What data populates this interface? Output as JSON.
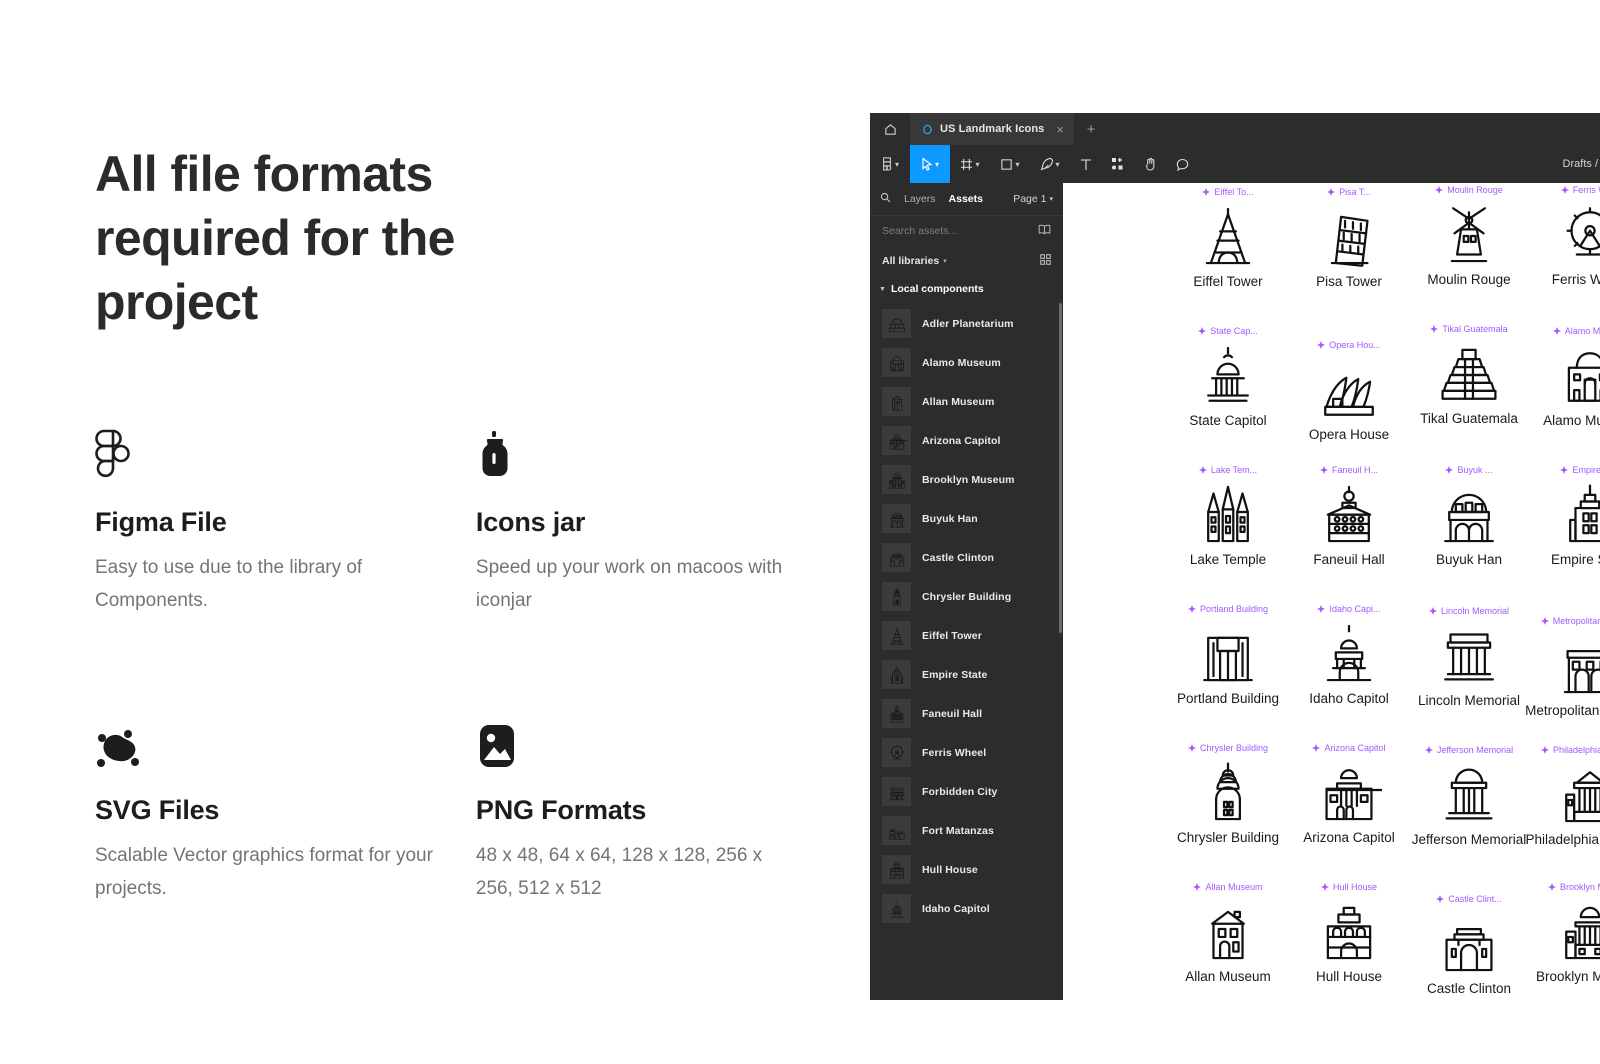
{
  "marketing": {
    "headline": "All file formats required for the project",
    "features": [
      {
        "icon": "figma-logo-icon",
        "title": "Figma File",
        "desc": "Easy to use due to the library of Components."
      },
      {
        "icon": "jar-icon",
        "title": "Icons jar",
        "desc": "Speed up your work on macoos with iconjar"
      },
      {
        "icon": "vector-node-icon",
        "title": "SVG Files",
        "desc": "Scalable Vector graphics format for your projects."
      },
      {
        "icon": "image-icon",
        "title": "PNG Formats",
        "desc": "48 x 48, 64 x 64, 128 x 128, 256 x 256, 512 x 512"
      }
    ]
  },
  "figma": {
    "tab": {
      "title": "US Landmark Icons",
      "close": "×",
      "new": "+"
    },
    "toolbar": {
      "tools": [
        {
          "name": "figma-menu-icon",
          "caret": true,
          "active": false
        },
        {
          "name": "move-tool-icon",
          "caret": true,
          "active": true
        },
        {
          "name": "frame-tool-icon",
          "caret": true,
          "active": false
        },
        {
          "name": "shape-tool-icon",
          "caret": true,
          "active": false
        },
        {
          "name": "pen-tool-icon",
          "caret": true,
          "active": false
        },
        {
          "name": "text-tool-icon",
          "caret": false,
          "active": false
        },
        {
          "name": "components-tool-icon",
          "caret": false,
          "active": false
        },
        {
          "name": "hand-tool-icon",
          "caret": false,
          "active": false
        },
        {
          "name": "comment-tool-icon",
          "caret": false,
          "active": false
        }
      ],
      "breadcrumb": "Drafts /"
    },
    "panel": {
      "tabs": [
        {
          "label": "Layers",
          "active": false
        },
        {
          "label": "Assets",
          "active": true
        }
      ],
      "page": "Page 1",
      "search_placeholder": "Search assets...",
      "library_label": "All libraries",
      "section_label": "Local components",
      "assets": [
        {
          "label": "Adler Planetarium",
          "icon": "planetarium-icon"
        },
        {
          "label": "Alamo Museum",
          "icon": "alamo-icon"
        },
        {
          "label": "Allan Museum",
          "icon": "house-icon"
        },
        {
          "label": "Arizona Capitol",
          "icon": "capitol-icon"
        },
        {
          "label": "Brooklyn Museum",
          "icon": "museum-icon"
        },
        {
          "label": "Buyuk Han",
          "icon": "dome-arch-icon"
        },
        {
          "label": "Castle Clinton",
          "icon": "castle-icon"
        },
        {
          "label": "Chrysler Building",
          "icon": "chrysler-icon"
        },
        {
          "label": "Eiffel Tower",
          "icon": "eiffel-icon"
        },
        {
          "label": "Empire State",
          "icon": "empire-icon"
        },
        {
          "label": "Faneuil Hall",
          "icon": "faneuil-icon"
        },
        {
          "label": "Ferris Wheel",
          "icon": "ferris-icon"
        },
        {
          "label": "Forbidden City",
          "icon": "forbidden-icon"
        },
        {
          "label": "Fort Matanzas",
          "icon": "fort-icon"
        },
        {
          "label": "Hull House",
          "icon": "hull-icon"
        },
        {
          "label": "Idaho Capitol",
          "icon": "idaho-icon"
        }
      ]
    },
    "canvas": {
      "components": [
        {
          "badge": "Eiffel To...",
          "label": "Eiffel Tower",
          "art": "eiffel",
          "col": 0,
          "row": 0,
          "yoff": 0
        },
        {
          "badge": "Pisa T...",
          "label": "Pisa Tower",
          "art": "pisa",
          "col": 1,
          "row": 0,
          "yoff": 0
        },
        {
          "badge": "Moulin Rouge",
          "label": "Moulin Rouge",
          "art": "moulin",
          "col": 2,
          "row": 0,
          "yoff": -2
        },
        {
          "badge": "Ferris Wh...",
          "label": "Ferris Wheel",
          "art": "ferris",
          "col": 3,
          "row": 0,
          "yoff": -2
        },
        {
          "badge": "State Cap...",
          "label": "State Capitol",
          "art": "capitol",
          "col": 0,
          "row": 1,
          "yoff": 0
        },
        {
          "badge": "Opera Hou...",
          "label": "Opera House",
          "art": "opera",
          "col": 1,
          "row": 1,
          "yoff": 14
        },
        {
          "badge": "Tikal Guatemala",
          "label": "Tikal Guatemala",
          "art": "tikal",
          "col": 2,
          "row": 1,
          "yoff": -2
        },
        {
          "badge": "Alamo Museum",
          "label": "Alamo Museum",
          "art": "alamo",
          "col": 3,
          "row": 1,
          "yoff": 0
        },
        {
          "badge": "Lake Tem...",
          "label": "Lake Temple",
          "art": "laketemple",
          "col": 0,
          "row": 2,
          "yoff": 0
        },
        {
          "badge": "Faneuil H...",
          "label": "Faneuil Hall",
          "art": "faneuil",
          "col": 1,
          "row": 2,
          "yoff": 0
        },
        {
          "badge": "Buyuk ...",
          "label": "Buyuk Han",
          "art": "buyuk",
          "col": 2,
          "row": 2,
          "yoff": 0
        },
        {
          "badge": "Empire St...",
          "label": "Empire State",
          "art": "empire",
          "col": 3,
          "row": 2,
          "yoff": 0
        },
        {
          "badge": "Portland Building",
          "label": "Portland Building",
          "art": "portland",
          "col": 0,
          "row": 3,
          "yoff": 0
        },
        {
          "badge": "Idaho Capi...",
          "label": "Idaho Capitol",
          "art": "idaho",
          "col": 1,
          "row": 3,
          "yoff": 0
        },
        {
          "badge": "Lincoln Memorial",
          "label": "Lincoln Memorial",
          "art": "lincoln",
          "col": 2,
          "row": 3,
          "yoff": 2
        },
        {
          "badge": "Metropolitan Museum",
          "label": "Metropolitan Museum",
          "art": "metro",
          "col": 3,
          "row": 3,
          "yoff": 12
        },
        {
          "badge": "Chrysler Building",
          "label": "Chrysler Building",
          "art": "chrysler",
          "col": 0,
          "row": 4,
          "yoff": 0
        },
        {
          "badge": "Arizona Capitol",
          "label": "Arizona Capitol",
          "art": "arizona",
          "col": 1,
          "row": 4,
          "yoff": 0
        },
        {
          "badge": "Jefferson Memorial",
          "label": "Jefferson Memorial",
          "art": "jefferson",
          "col": 2,
          "row": 4,
          "yoff": 2
        },
        {
          "badge": "Philadelphia Museum",
          "label": "Philadelphia Museum",
          "art": "philly",
          "col": 3,
          "row": 4,
          "yoff": 2
        },
        {
          "badge": "Allan Museum",
          "label": "Allan Museum",
          "art": "allan",
          "col": 0,
          "row": 5,
          "yoff": 0
        },
        {
          "badge": "Hull House",
          "label": "Hull House",
          "art": "hull",
          "col": 1,
          "row": 5,
          "yoff": 0
        },
        {
          "badge": "Castle Clint...",
          "label": "Castle Clinton",
          "art": "castle",
          "col": 2,
          "row": 5,
          "yoff": 12
        },
        {
          "badge": "Brooklyn Museum",
          "label": "Brooklyn Museum",
          "art": "brooklyn",
          "col": 3,
          "row": 5,
          "yoff": 0
        }
      ]
    }
  },
  "colors": {
    "accent": "#0d99ff",
    "component_purple": "#a259ff",
    "panel_bg": "#2c2c2c",
    "text_dark": "#1d1d1d",
    "text_muted": "#71757a"
  }
}
